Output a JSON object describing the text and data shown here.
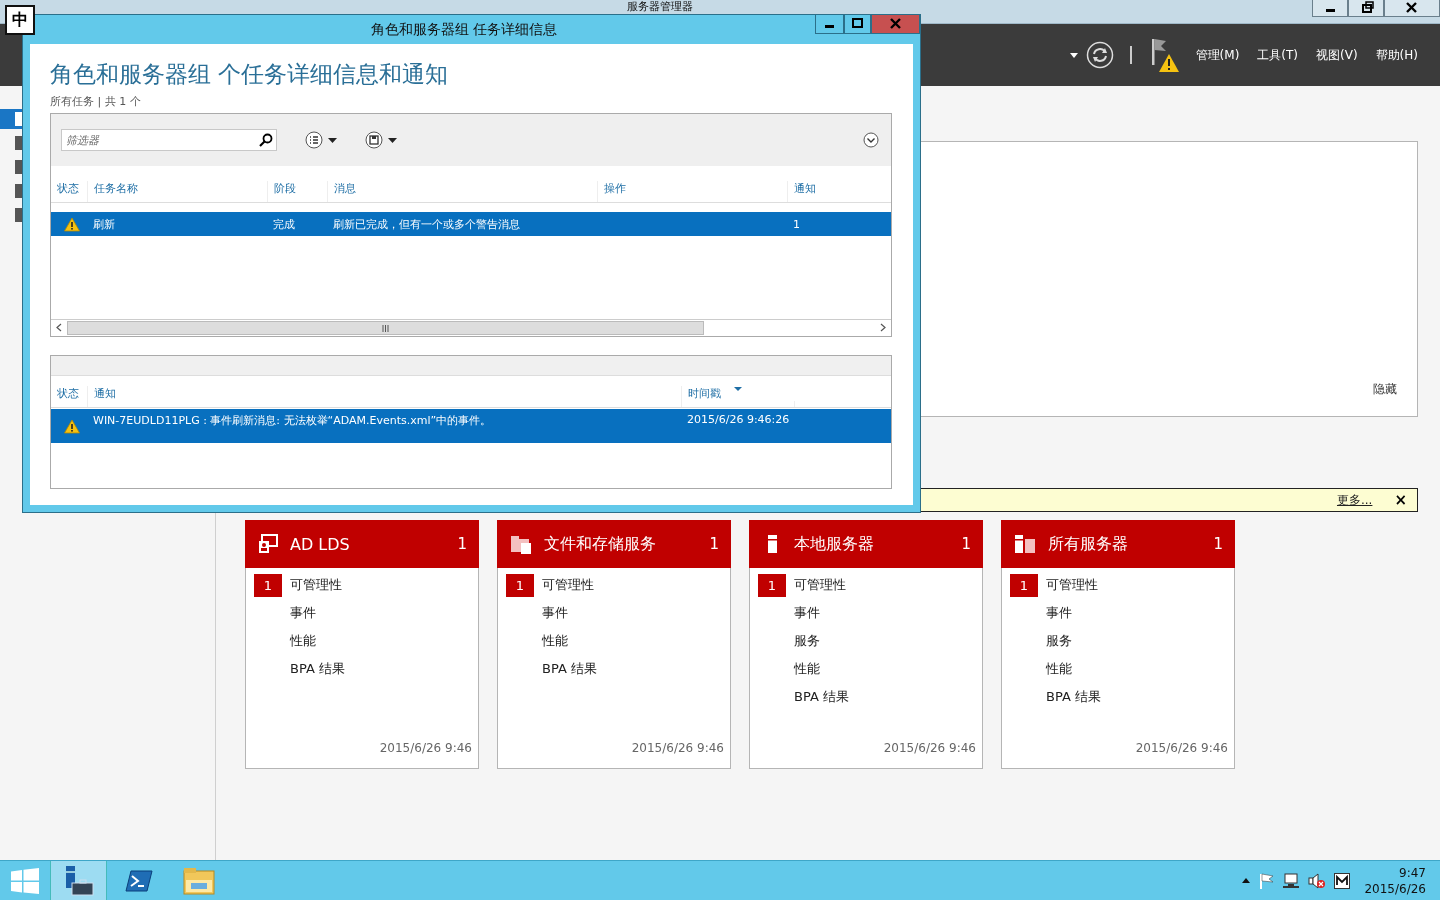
{
  "ime_indicator": "中",
  "main_window": {
    "title": "服务器管理器",
    "menu": [
      "管理(M)",
      "工具(T)",
      "视图(V)",
      "帮助(H)"
    ],
    "sidebar": {
      "items": [
        {
          "selected": true
        },
        {
          "selected": false
        },
        {
          "selected": false
        },
        {
          "selected": false
        },
        {
          "selected": false
        }
      ]
    },
    "hide_link": "隐藏",
    "notification_bar": {
      "link": "更多...",
      "close": "×"
    },
    "tiles": [
      {
        "kind": "role",
        "title": "AD LDS",
        "count": "1",
        "items": [
          {
            "label": "可管理性",
            "badge": "1"
          },
          {
            "label": "事件"
          },
          {
            "label": "性能"
          },
          {
            "label": "BPA 结果"
          }
        ],
        "timestamp": "2015/6/26 9:46"
      },
      {
        "kind": "folder",
        "title": "文件和存储服务",
        "count": "1",
        "items": [
          {
            "label": "可管理性",
            "badge": "1"
          },
          {
            "label": "事件"
          },
          {
            "label": "性能"
          },
          {
            "label": "BPA 结果"
          }
        ],
        "timestamp": "2015/6/26 9:46"
      },
      {
        "kind": "server",
        "title": "本地服务器",
        "count": "1",
        "items": [
          {
            "label": "可管理性",
            "badge": "1"
          },
          {
            "label": "事件"
          },
          {
            "label": "服务"
          },
          {
            "label": "性能"
          },
          {
            "label": "BPA 结果"
          }
        ],
        "timestamp": "2015/6/26 9:46"
      },
      {
        "kind": "servers",
        "title": "所有服务器",
        "count": "1",
        "items": [
          {
            "label": "可管理性",
            "badge": "1"
          },
          {
            "label": "事件"
          },
          {
            "label": "服务"
          },
          {
            "label": "性能"
          },
          {
            "label": "BPA 结果"
          }
        ],
        "timestamp": "2015/6/26 9:46"
      }
    ]
  },
  "dialog": {
    "title": "角色和服务器组 任务详细信息",
    "heading": "角色和服务器组 个任务详细信息和通知",
    "subtitle": "所有任务 | 共 1 个",
    "filter": {
      "placeholder": "筛选器"
    },
    "tasks": {
      "columns": [
        "状态",
        "任务名称",
        "阶段",
        "消息",
        "操作",
        "通知"
      ],
      "rows": [
        {
          "selected": true,
          "kind": "warning",
          "cells": [
            "",
            "刷新",
            "完成",
            "刷新已完成，但有一个或多个警告消息",
            "",
            "1"
          ]
        }
      ]
    },
    "notifications": {
      "columns": [
        "状态",
        "通知",
        "时间戳"
      ],
      "rows": [
        {
          "selected": true,
          "kind": "warning",
          "cells": [
            "",
            "WIN-7EUDLD11PLG : 事件刷新消息: 无法枚举“ADAM.Events.xml”中的事件。",
            "2015/6/26 9:46:26"
          ]
        }
      ]
    }
  },
  "taskbar": {
    "apps": [
      {
        "kind": "server-manager",
        "selected": true
      },
      {
        "kind": "powershell",
        "selected": false
      },
      {
        "kind": "explorer",
        "selected": false
      }
    ],
    "time": "9:47",
    "date": "2015/6/26"
  }
}
